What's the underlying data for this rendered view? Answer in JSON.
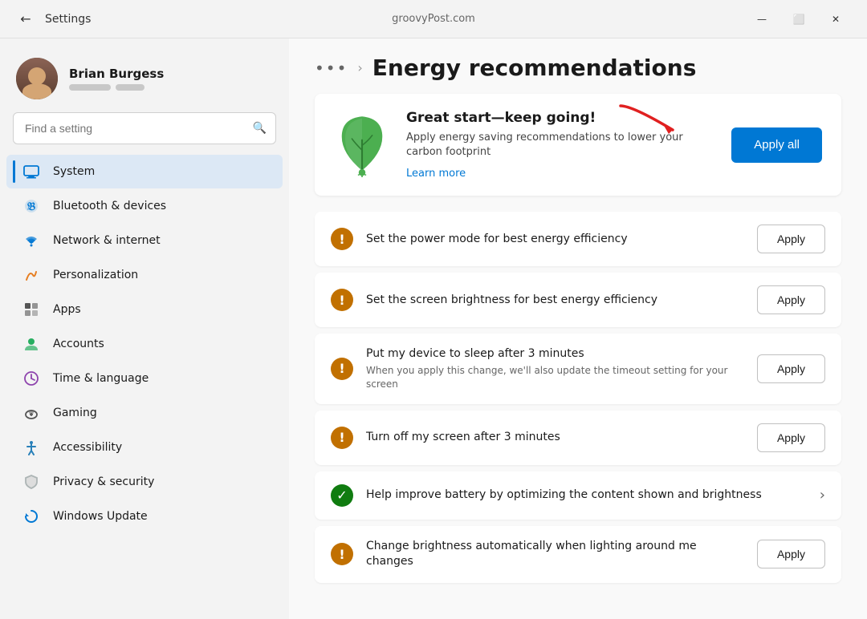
{
  "titlebar": {
    "back_label": "←",
    "app_title": "Settings",
    "url": "groovyPost.com",
    "minimize": "—",
    "restore": "⬜",
    "close": "✕"
  },
  "sidebar": {
    "user": {
      "name": "Brian Burgess"
    },
    "search_placeholder": "Find a setting",
    "nav_items": [
      {
        "id": "system",
        "label": "System",
        "active": true
      },
      {
        "id": "bluetooth",
        "label": "Bluetooth & devices",
        "active": false
      },
      {
        "id": "network",
        "label": "Network & internet",
        "active": false
      },
      {
        "id": "personalization",
        "label": "Personalization",
        "active": false
      },
      {
        "id": "apps",
        "label": "Apps",
        "active": false
      },
      {
        "id": "accounts",
        "label": "Accounts",
        "active": false
      },
      {
        "id": "time",
        "label": "Time & language",
        "active": false
      },
      {
        "id": "gaming",
        "label": "Gaming",
        "active": false
      },
      {
        "id": "accessibility",
        "label": "Accessibility",
        "active": false
      },
      {
        "id": "privacy",
        "label": "Privacy & security",
        "active": false
      },
      {
        "id": "update",
        "label": "Windows Update",
        "active": false
      }
    ]
  },
  "main": {
    "breadcrumb_dots": "•••",
    "breadcrumb_sep": ">",
    "page_title": "Energy recommendations",
    "promo": {
      "title": "Great start—keep going!",
      "description": "Apply energy saving recommendations to lower your carbon footprint",
      "link_label": "Learn more",
      "apply_all_label": "Apply all"
    },
    "recommendations": [
      {
        "id": "power-mode",
        "icon_type": "warning",
        "title": "Set the power mode for best energy efficiency",
        "subtitle": "",
        "action": "apply",
        "action_label": "Apply"
      },
      {
        "id": "brightness",
        "icon_type": "warning",
        "title": "Set the screen brightness for best energy efficiency",
        "subtitle": "",
        "action": "apply",
        "action_label": "Apply"
      },
      {
        "id": "sleep-3min",
        "icon_type": "warning",
        "title": "Put my device to sleep after 3 minutes",
        "subtitle": "When you apply this change, we'll also update the timeout setting for your screen",
        "action": "apply",
        "action_label": "Apply"
      },
      {
        "id": "screen-off",
        "icon_type": "warning",
        "title": "Turn off my screen after 3 minutes",
        "subtitle": "",
        "action": "apply",
        "action_label": "Apply"
      },
      {
        "id": "battery-optimize",
        "icon_type": "success",
        "title": "Help improve battery by optimizing the content shown and brightness",
        "subtitle": "",
        "action": "chevron",
        "action_label": "›"
      },
      {
        "id": "auto-brightness",
        "icon_type": "warning",
        "title": "Change brightness automatically when lighting around me changes",
        "subtitle": "",
        "action": "apply",
        "action_label": "Apply"
      }
    ]
  }
}
